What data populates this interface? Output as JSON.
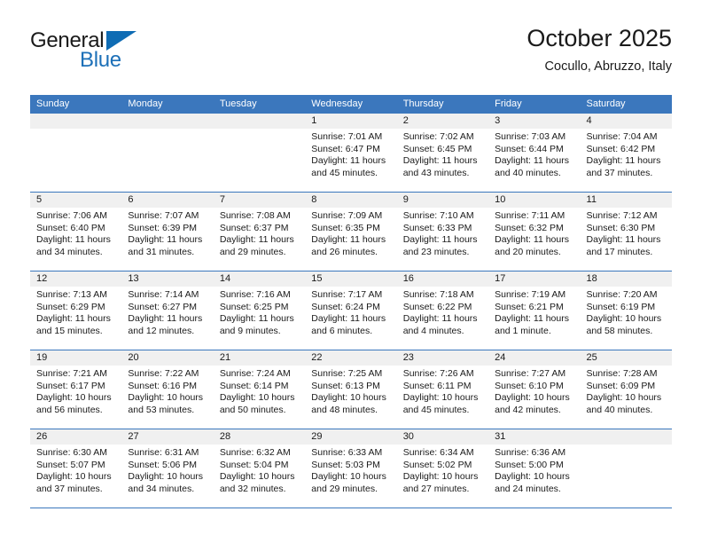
{
  "brand": {
    "line1": "General",
    "line2": "Blue",
    "triangle_icon": "triangle-icon",
    "accent_color": "#0f6cb4"
  },
  "header": {
    "title": "October 2025",
    "subtitle": "Cocullo, Abruzzo, Italy"
  },
  "colors": {
    "header_blue": "#3b77bd",
    "number_band": "#f0f0f0",
    "text": "#1a1a1a"
  },
  "weekdays": [
    "Sunday",
    "Monday",
    "Tuesday",
    "Wednesday",
    "Thursday",
    "Friday",
    "Saturday"
  ],
  "weeks": [
    [
      {
        "day": "",
        "sunrise": "",
        "sunset": "",
        "daylight1": "",
        "daylight2": ""
      },
      {
        "day": "",
        "sunrise": "",
        "sunset": "",
        "daylight1": "",
        "daylight2": ""
      },
      {
        "day": "",
        "sunrise": "",
        "sunset": "",
        "daylight1": "",
        "daylight2": ""
      },
      {
        "day": "1",
        "sunrise": "Sunrise: 7:01 AM",
        "sunset": "Sunset: 6:47 PM",
        "daylight1": "Daylight: 11 hours",
        "daylight2": "and 45 minutes."
      },
      {
        "day": "2",
        "sunrise": "Sunrise: 7:02 AM",
        "sunset": "Sunset: 6:45 PM",
        "daylight1": "Daylight: 11 hours",
        "daylight2": "and 43 minutes."
      },
      {
        "day": "3",
        "sunrise": "Sunrise: 7:03 AM",
        "sunset": "Sunset: 6:44 PM",
        "daylight1": "Daylight: 11 hours",
        "daylight2": "and 40 minutes."
      },
      {
        "day": "4",
        "sunrise": "Sunrise: 7:04 AM",
        "sunset": "Sunset: 6:42 PM",
        "daylight1": "Daylight: 11 hours",
        "daylight2": "and 37 minutes."
      }
    ],
    [
      {
        "day": "5",
        "sunrise": "Sunrise: 7:06 AM",
        "sunset": "Sunset: 6:40 PM",
        "daylight1": "Daylight: 11 hours",
        "daylight2": "and 34 minutes."
      },
      {
        "day": "6",
        "sunrise": "Sunrise: 7:07 AM",
        "sunset": "Sunset: 6:39 PM",
        "daylight1": "Daylight: 11 hours",
        "daylight2": "and 31 minutes."
      },
      {
        "day": "7",
        "sunrise": "Sunrise: 7:08 AM",
        "sunset": "Sunset: 6:37 PM",
        "daylight1": "Daylight: 11 hours",
        "daylight2": "and 29 minutes."
      },
      {
        "day": "8",
        "sunrise": "Sunrise: 7:09 AM",
        "sunset": "Sunset: 6:35 PM",
        "daylight1": "Daylight: 11 hours",
        "daylight2": "and 26 minutes."
      },
      {
        "day": "9",
        "sunrise": "Sunrise: 7:10 AM",
        "sunset": "Sunset: 6:33 PM",
        "daylight1": "Daylight: 11 hours",
        "daylight2": "and 23 minutes."
      },
      {
        "day": "10",
        "sunrise": "Sunrise: 7:11 AM",
        "sunset": "Sunset: 6:32 PM",
        "daylight1": "Daylight: 11 hours",
        "daylight2": "and 20 minutes."
      },
      {
        "day": "11",
        "sunrise": "Sunrise: 7:12 AM",
        "sunset": "Sunset: 6:30 PM",
        "daylight1": "Daylight: 11 hours",
        "daylight2": "and 17 minutes."
      }
    ],
    [
      {
        "day": "12",
        "sunrise": "Sunrise: 7:13 AM",
        "sunset": "Sunset: 6:29 PM",
        "daylight1": "Daylight: 11 hours",
        "daylight2": "and 15 minutes."
      },
      {
        "day": "13",
        "sunrise": "Sunrise: 7:14 AM",
        "sunset": "Sunset: 6:27 PM",
        "daylight1": "Daylight: 11 hours",
        "daylight2": "and 12 minutes."
      },
      {
        "day": "14",
        "sunrise": "Sunrise: 7:16 AM",
        "sunset": "Sunset: 6:25 PM",
        "daylight1": "Daylight: 11 hours",
        "daylight2": "and 9 minutes."
      },
      {
        "day": "15",
        "sunrise": "Sunrise: 7:17 AM",
        "sunset": "Sunset: 6:24 PM",
        "daylight1": "Daylight: 11 hours",
        "daylight2": "and 6 minutes."
      },
      {
        "day": "16",
        "sunrise": "Sunrise: 7:18 AM",
        "sunset": "Sunset: 6:22 PM",
        "daylight1": "Daylight: 11 hours",
        "daylight2": "and 4 minutes."
      },
      {
        "day": "17",
        "sunrise": "Sunrise: 7:19 AM",
        "sunset": "Sunset: 6:21 PM",
        "daylight1": "Daylight: 11 hours",
        "daylight2": "and 1 minute."
      },
      {
        "day": "18",
        "sunrise": "Sunrise: 7:20 AM",
        "sunset": "Sunset: 6:19 PM",
        "daylight1": "Daylight: 10 hours",
        "daylight2": "and 58 minutes."
      }
    ],
    [
      {
        "day": "19",
        "sunrise": "Sunrise: 7:21 AM",
        "sunset": "Sunset: 6:17 PM",
        "daylight1": "Daylight: 10 hours",
        "daylight2": "and 56 minutes."
      },
      {
        "day": "20",
        "sunrise": "Sunrise: 7:22 AM",
        "sunset": "Sunset: 6:16 PM",
        "daylight1": "Daylight: 10 hours",
        "daylight2": "and 53 minutes."
      },
      {
        "day": "21",
        "sunrise": "Sunrise: 7:24 AM",
        "sunset": "Sunset: 6:14 PM",
        "daylight1": "Daylight: 10 hours",
        "daylight2": "and 50 minutes."
      },
      {
        "day": "22",
        "sunrise": "Sunrise: 7:25 AM",
        "sunset": "Sunset: 6:13 PM",
        "daylight1": "Daylight: 10 hours",
        "daylight2": "and 48 minutes."
      },
      {
        "day": "23",
        "sunrise": "Sunrise: 7:26 AM",
        "sunset": "Sunset: 6:11 PM",
        "daylight1": "Daylight: 10 hours",
        "daylight2": "and 45 minutes."
      },
      {
        "day": "24",
        "sunrise": "Sunrise: 7:27 AM",
        "sunset": "Sunset: 6:10 PM",
        "daylight1": "Daylight: 10 hours",
        "daylight2": "and 42 minutes."
      },
      {
        "day": "25",
        "sunrise": "Sunrise: 7:28 AM",
        "sunset": "Sunset: 6:09 PM",
        "daylight1": "Daylight: 10 hours",
        "daylight2": "and 40 minutes."
      }
    ],
    [
      {
        "day": "26",
        "sunrise": "Sunrise: 6:30 AM",
        "sunset": "Sunset: 5:07 PM",
        "daylight1": "Daylight: 10 hours",
        "daylight2": "and 37 minutes."
      },
      {
        "day": "27",
        "sunrise": "Sunrise: 6:31 AM",
        "sunset": "Sunset: 5:06 PM",
        "daylight1": "Daylight: 10 hours",
        "daylight2": "and 34 minutes."
      },
      {
        "day": "28",
        "sunrise": "Sunrise: 6:32 AM",
        "sunset": "Sunset: 5:04 PM",
        "daylight1": "Daylight: 10 hours",
        "daylight2": "and 32 minutes."
      },
      {
        "day": "29",
        "sunrise": "Sunrise: 6:33 AM",
        "sunset": "Sunset: 5:03 PM",
        "daylight1": "Daylight: 10 hours",
        "daylight2": "and 29 minutes."
      },
      {
        "day": "30",
        "sunrise": "Sunrise: 6:34 AM",
        "sunset": "Sunset: 5:02 PM",
        "daylight1": "Daylight: 10 hours",
        "daylight2": "and 27 minutes."
      },
      {
        "day": "31",
        "sunrise": "Sunrise: 6:36 AM",
        "sunset": "Sunset: 5:00 PM",
        "daylight1": "Daylight: 10 hours",
        "daylight2": "and 24 minutes."
      },
      {
        "day": "",
        "sunrise": "",
        "sunset": "",
        "daylight1": "",
        "daylight2": ""
      }
    ]
  ]
}
